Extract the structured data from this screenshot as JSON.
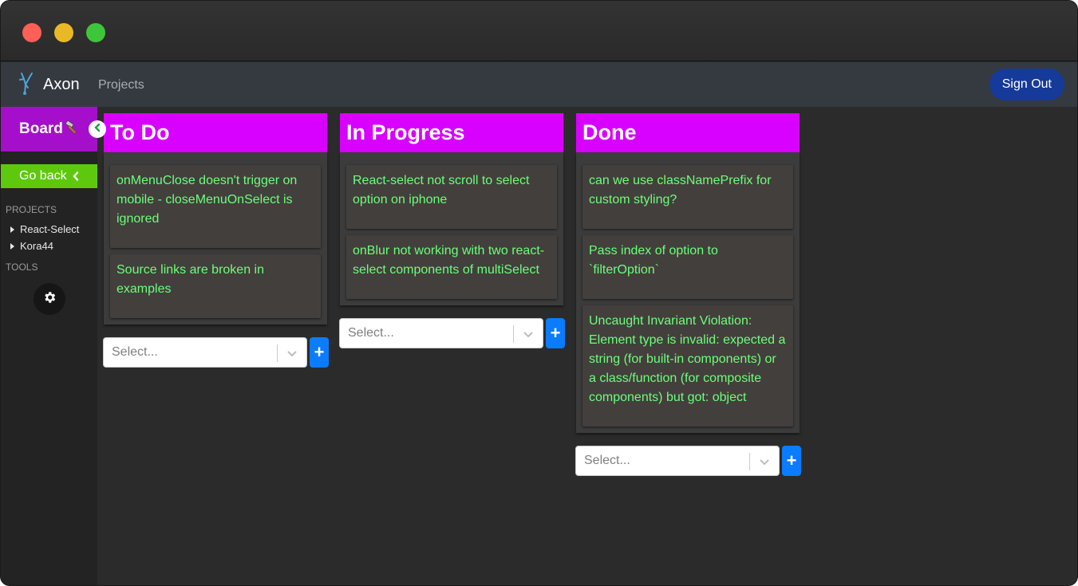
{
  "window": {
    "traffic_lights": {
      "close": "#ff5f57",
      "minimize": "#e9b925",
      "maximize": "#3ec63a"
    }
  },
  "navbar": {
    "brand": "Axon",
    "link": "Projects",
    "signout_label": "Sign Out",
    "logo_icon": "neuron-icon",
    "colors": {
      "bg": "#343a40",
      "signout": "#163a99"
    }
  },
  "sidebar": {
    "board_label": "Board",
    "board_icon": "hammer-icon",
    "goback_label": "Go back",
    "projects_label": "PROJECTS",
    "projects": [
      "React-Select",
      "Kora44"
    ],
    "tools_label": "TOOLS",
    "tools_icon": "gear-icon",
    "colors": {
      "board": "#a50fcc",
      "goback": "#5ec80e"
    }
  },
  "board": {
    "columns": [
      {
        "title": "To Do",
        "cards": [
          "onMenuClose doesn't trigger on mobile - closeMenuOnSelect is ignored",
          "Source links are broken in examples"
        ],
        "select_placeholder": "Select..."
      },
      {
        "title": "In Progress",
        "cards": [
          "React-select not scroll to select option on iphone",
          "onBlur not working with two react-select components of multiSelect"
        ],
        "select_placeholder": "Select..."
      },
      {
        "title": "Done",
        "cards": [
          "can we use classNamePrefix for custom styling?",
          "Pass index of option to `filterOption`",
          "Uncaught Invariant Violation: Element type is invalid: expected a string (for built-in components) or a class/function (for composite components) but got: object"
        ],
        "select_placeholder": "Select..."
      }
    ],
    "add_button_label": "+",
    "colors": {
      "header": "#d800ff",
      "card_text": "#6bff7a",
      "add_button": "#0b7cff"
    }
  }
}
